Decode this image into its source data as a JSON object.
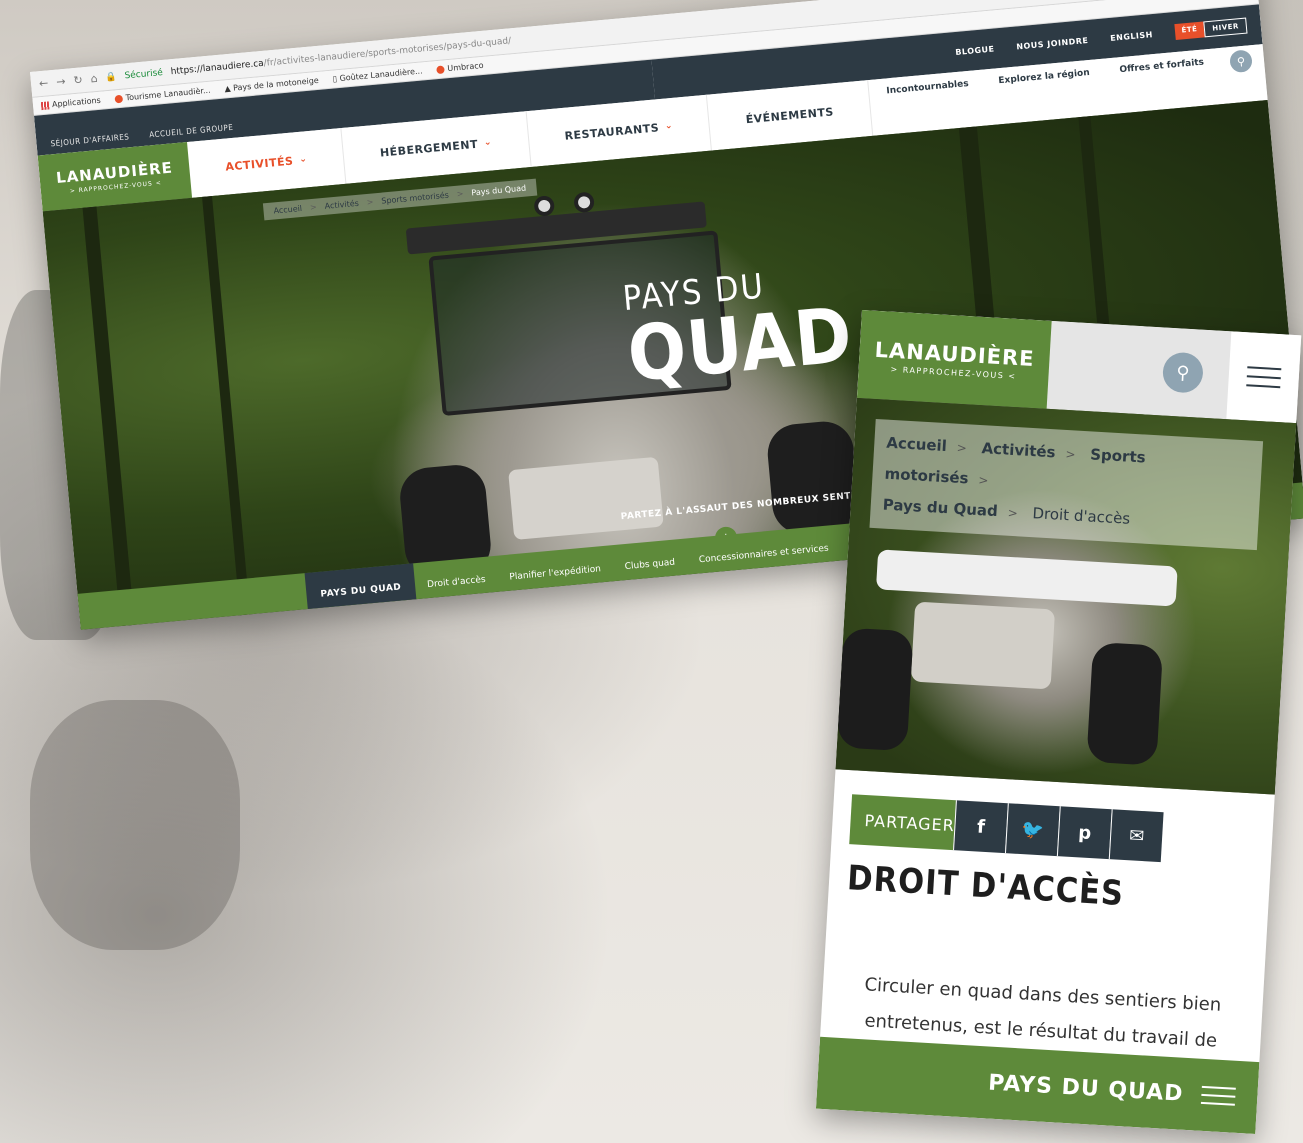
{
  "browser": {
    "secure_label": "Sécurisé",
    "url_host": "https://lanaudiere.ca",
    "url_path": "/fr/activites-lanaudiere/sports-motorises/pays-du-quad/",
    "bookmarks": [
      "Applications",
      "Tourisme Lanaudièr...",
      "Pays de la motoneige",
      "Goûtez Lanaudière...",
      "Umbraco"
    ]
  },
  "topbar": {
    "left_links": [
      "SÉJOUR D'AFFAIRES",
      "ACCUEIL DE GROUPE"
    ],
    "right_links": [
      "BLOGUE",
      "NOUS JOINDRE",
      "ENGLISH"
    ],
    "season_summer": "ÉTÉ",
    "season_winter": "HIVER"
  },
  "logo": {
    "name": "LANAUDIÈRE",
    "tagline": "> RAPPROCHEZ-VOUS <"
  },
  "main_nav": [
    {
      "label": "ACTIVITÉS",
      "has_dropdown": true
    },
    {
      "label": "HÉBERGEMENT",
      "has_dropdown": true
    },
    {
      "label": "RESTAURANTS",
      "has_dropdown": true
    },
    {
      "label": "ÉVÉNEMENTS",
      "has_dropdown": false
    }
  ],
  "util_links": [
    "Incontournables",
    "Explorez la région",
    "Offres et forfaits"
  ],
  "desktop_breadcrumb": [
    "Accueil",
    "Activités",
    "Sports motorisés",
    "Pays du Quad"
  ],
  "hero": {
    "title_small": "PAYS DU",
    "title_big": "QUAD",
    "tagline": "PARTEZ À L'ASSAUT DES NOMBREUX SENTIERS"
  },
  "sub_nav": [
    {
      "label": "PAYS DU QUAD",
      "active": true
    },
    {
      "label": "Droit d'accès",
      "active": false
    },
    {
      "label": "Planifier l'expédition",
      "active": false
    },
    {
      "label": "Clubs quad",
      "active": false
    },
    {
      "label": "Concessionnaires et services",
      "active": false
    }
  ],
  "mobile": {
    "breadcrumb": [
      "Accueil",
      "Activités",
      "Sports motorisés",
      "Pays du Quad",
      "Droit d'accès"
    ],
    "share_label": "PARTAGER",
    "share_icons": [
      "f",
      "🐦",
      "p",
      "✉"
    ],
    "page_title": "DROIT D'ACCÈS",
    "body_text": "Circuler en quad dans des sentiers bien entretenus, est le résultat du travail de",
    "footer_label": "PAYS DU QUAD"
  },
  "colors": {
    "brand_green": "#5e8a3a",
    "dark_slate": "#2d3a44",
    "accent_orange": "#e8502a"
  }
}
